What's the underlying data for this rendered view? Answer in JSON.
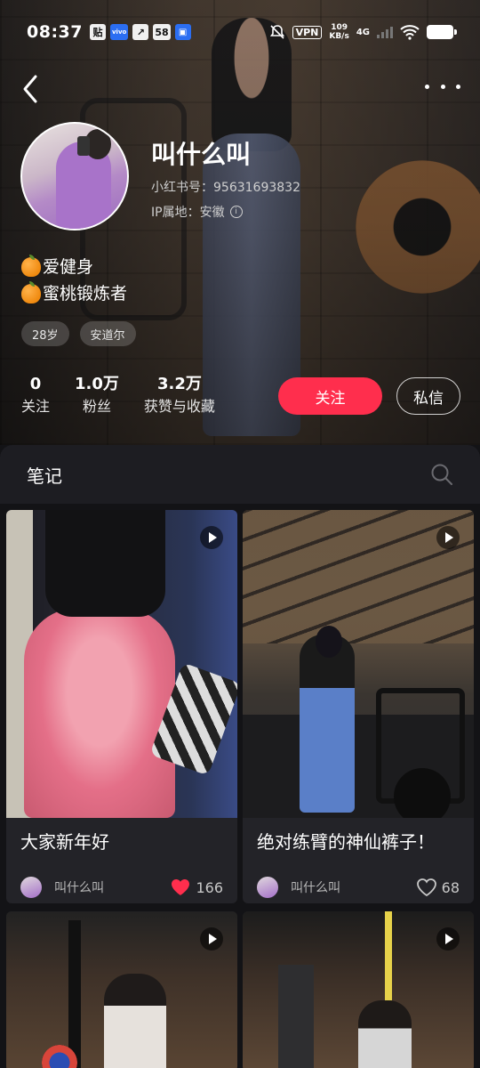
{
  "status_bar": {
    "time": "08:37",
    "left_icons": [
      "贴",
      "vivo",
      "↗",
      "58",
      "💼"
    ],
    "vpn": "VPN",
    "speed_value": "109",
    "speed_unit": "KB/s",
    "network": "4G"
  },
  "profile": {
    "username": "叫什么叫",
    "red_id": "小红书号：95631693832",
    "ip_location": "IP属地：安徽",
    "info_glyph": "i",
    "bio": [
      "爱健身",
      "蜜桃锻炼者"
    ],
    "tags": [
      "28岁",
      "安道尔"
    ],
    "stats": [
      {
        "value": "0",
        "label": "关注"
      },
      {
        "value": "1.0万",
        "label": "粉丝"
      },
      {
        "value": "3.2万",
        "label": "获赞与收藏"
      }
    ],
    "follow_label": "关注",
    "message_label": "私信",
    "follow_color": "#ff2e4d"
  },
  "notes": {
    "title": "笔记",
    "cards": [
      {
        "title": "大家新年好",
        "author": "叫什么叫",
        "likes": "166",
        "liked": true,
        "is_video": true
      },
      {
        "title": "绝对练臂的神仙裤子！",
        "author": "叫什么叫",
        "likes": "68",
        "liked": false,
        "is_video": true
      },
      {
        "title": "",
        "author": "",
        "likes": "",
        "liked": false,
        "is_video": true
      },
      {
        "title": "",
        "author": "",
        "likes": "",
        "liked": false,
        "is_video": true
      }
    ]
  }
}
